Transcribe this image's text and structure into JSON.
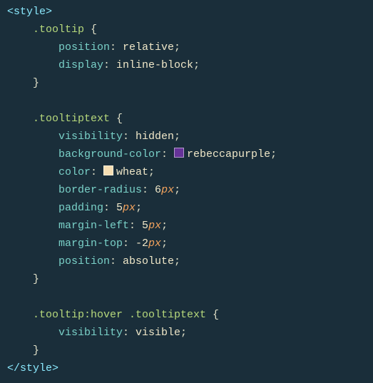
{
  "tags": {
    "open": "<style>",
    "close": "</style>"
  },
  "sel": {
    "tooltip": ".tooltip",
    "tooltiptext": ".tooltiptext",
    "hover": ".tooltip:hover .tooltiptext"
  },
  "prop": {
    "position": "position",
    "display": "display",
    "visibility": "visibility",
    "bgcolor": "background-color",
    "color": "color",
    "bradius": "border-radius",
    "padding": "padding",
    "ml": "margin-left",
    "mt": "margin-top"
  },
  "val": {
    "relative": "relative",
    "inlineblock": "inline-block",
    "hidden": "hidden",
    "rebeccapurple": "rebeccapurple",
    "wheat": "wheat",
    "absolute": "absolute",
    "visible": "visible"
  },
  "num": {
    "six": "6",
    "five": "5",
    "five2": "5",
    "neg2": "-2"
  },
  "unit": {
    "px": "px"
  },
  "punc": {
    "ob": " {",
    "cb": "}",
    "colon": ": ",
    "semi": ";"
  }
}
